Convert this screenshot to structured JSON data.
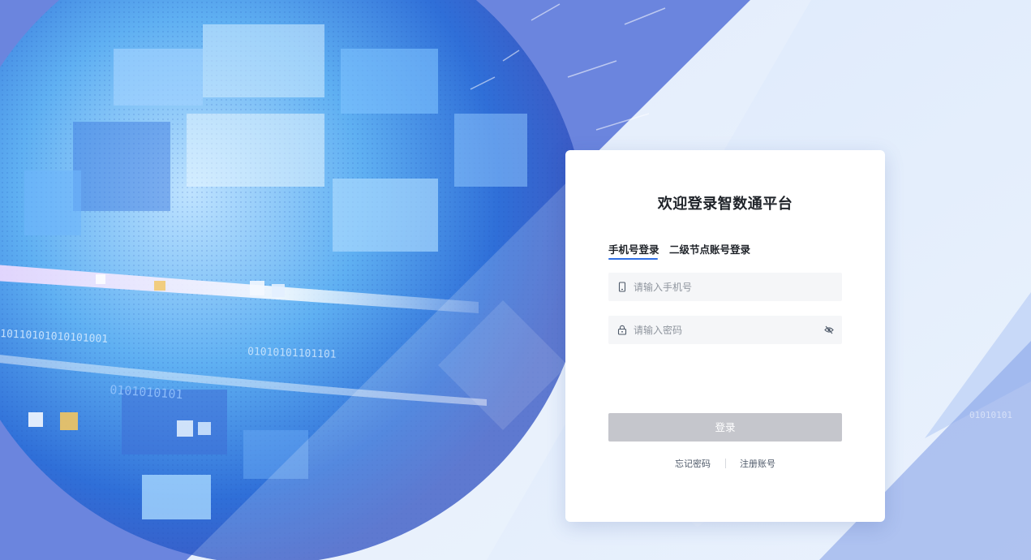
{
  "login": {
    "title": "欢迎登录智数通平台",
    "tabs": [
      {
        "label": "手机号登录",
        "active": true
      },
      {
        "label": "二级节点账号登录",
        "active": false
      }
    ],
    "phone": {
      "placeholder": "请输入手机号",
      "value": "",
      "icon": "phone-icon"
    },
    "password": {
      "placeholder": "请输入密码",
      "value": "",
      "icon": "lock-icon",
      "toggle_icon": "eye-slash-icon"
    },
    "submit_label": "登录",
    "links": {
      "forgot": "忘记密码",
      "register": "注册账号"
    }
  },
  "background": {
    "binary_text": [
      "10110101010101001",
      "01010101101101",
      "0101010101",
      "01010101"
    ],
    "accent": "#2f6fe4",
    "card_bg": "#ffffff",
    "button_disabled": "#c5c6cc"
  }
}
